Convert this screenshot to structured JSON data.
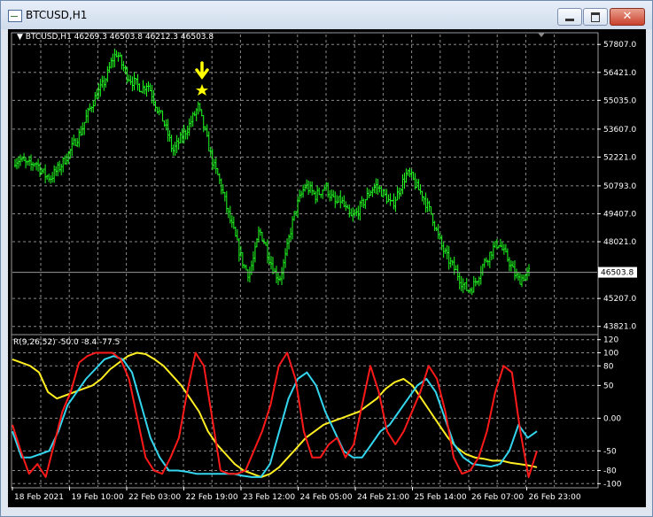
{
  "window": {
    "title": "BTCUSD,H1",
    "buttons": {
      "minimize": "minimize",
      "maximize": "maximize",
      "close": "✕"
    }
  },
  "price_pane": {
    "header": "▼ BTCUSD,H1  46269.3 46503.8 46212.3 46503.8",
    "current_price_label": "46503.8",
    "y_ticks": [
      "57807.0",
      "56421.0",
      "55035.0",
      "53607.0",
      "52221.0",
      "50793.0",
      "49407.0",
      "48021.0",
      "45207.0",
      "43821.0"
    ],
    "marker_icons": [
      "arrow-down-icon",
      "star-icon"
    ],
    "colors": {
      "candles": "#20ff20",
      "marker": "#ffff00",
      "grid": "#8a8a8a"
    }
  },
  "indicator_pane": {
    "header": "R(9,26,52) -50.0 -8.4 -77.5",
    "y_ticks": [
      "120",
      "100",
      "80",
      "50",
      "0.00",
      "-50",
      "-80",
      "-100"
    ],
    "colors": {
      "fast": "#ff1a1a",
      "mid": "#33d6ee",
      "slow": "#ffee22"
    }
  },
  "x_axis": {
    "labels": [
      "18 Feb 2021",
      "19 Feb 10:00",
      "22 Feb 03:00",
      "22 Feb 19:00",
      "23 Feb 12:00",
      "24 Feb 05:00",
      "24 Feb 21:00",
      "25 Feb 14:00",
      "26 Feb 07:00",
      "26 Feb 23:00"
    ]
  },
  "chart_data": [
    {
      "type": "candlestick",
      "y_ticks": [
        57807.0,
        56421.0,
        55035.0,
        53607.0,
        52221.0,
        50793.0,
        49407.0,
        48021.0,
        45207.0,
        43821.0
      ],
      "ylim": [
        43500,
        58300
      ],
      "last_price": 46503.8,
      "ohlc_last": [
        46269.3,
        46503.8,
        46212.3,
        46503.8
      ],
      "close_path": [
        52050,
        52100,
        51900,
        51800,
        52000,
        51600,
        51300,
        51200,
        51500,
        51800,
        52200,
        52600,
        53100,
        53500,
        54200,
        54800,
        55300,
        55700,
        56200,
        57000,
        57400,
        56800,
        56300,
        56000,
        55800,
        55600,
        55900,
        55300,
        54600,
        54100,
        53400,
        52500,
        52900,
        53300,
        53700,
        54200,
        54700,
        53800,
        52800,
        51800,
        51200,
        50300,
        49300,
        48500,
        47600,
        46800,
        46400,
        47300,
        48600,
        48000,
        47200,
        46500,
        46200,
        47100,
        48400,
        49500,
        50200,
        50800,
        50600,
        50300,
        50500,
        50800,
        50300,
        49900,
        50100,
        49600,
        49200,
        49400,
        49800,
        50200,
        50600,
        50800,
        50500,
        50200,
        49800,
        50300,
        50900,
        51400,
        51200,
        50700,
        50400,
        49800,
        49300,
        48400,
        47700,
        47200,
        46800,
        46400,
        45900,
        45600,
        45800,
        46300,
        46900,
        47300,
        47700,
        48000,
        47500,
        47100,
        46500,
        46100,
        46300,
        46500
      ]
    },
    {
      "type": "line",
      "series_values": {
        "fast": [
          -10,
          -50,
          -85,
          -70,
          -90,
          -40,
          10,
          40,
          85,
          95,
          100,
          100,
          100,
          90,
          60,
          0,
          -60,
          -80,
          -85,
          -60,
          -30,
          40,
          100,
          80,
          0,
          -80,
          -85,
          -85,
          -80,
          -50,
          -20,
          20,
          80,
          100,
          60,
          -20,
          -60,
          -60,
          -40,
          -30,
          -60,
          -40,
          20,
          80,
          40,
          -20,
          -40,
          -20,
          10,
          40,
          80,
          60,
          10,
          -60,
          -85,
          -80,
          -60,
          -20,
          40,
          80,
          70,
          -20,
          -90,
          -50
        ],
        "mid": [
          -20,
          -60,
          -60,
          -55,
          -50,
          -20,
          20,
          40,
          60,
          75,
          90,
          95,
          90,
          70,
          20,
          -30,
          -60,
          -80,
          -80,
          -82,
          -85,
          -85,
          -85,
          -85,
          -85,
          -88,
          -90,
          -90,
          -70,
          -20,
          30,
          60,
          70,
          50,
          10,
          -20,
          -50,
          -60,
          -60,
          -40,
          -20,
          -10,
          10,
          30,
          50,
          60,
          40,
          0,
          -40,
          -60,
          -70,
          -72,
          -74,
          -70,
          -50,
          -10,
          -30,
          -20
        ],
        "slow": [
          90,
          85,
          80,
          70,
          40,
          30,
          35,
          40,
          45,
          50,
          60,
          75,
          85,
          95,
          100,
          98,
          90,
          80,
          65,
          50,
          30,
          10,
          -20,
          -40,
          -55,
          -70,
          -80,
          -85,
          -90,
          -85,
          -75,
          -60,
          -45,
          -30,
          -20,
          -10,
          -5,
          0,
          5,
          10,
          20,
          30,
          45,
          55,
          60,
          50,
          30,
          10,
          -10,
          -30,
          -45,
          -55,
          -60,
          -62,
          -65,
          -65,
          -68,
          -70,
          -72,
          -75
        ]
      },
      "y_ticks": [
        120,
        100,
        80,
        50,
        0,
        -50,
        -80,
        -100
      ],
      "ylim": [
        -105,
        125
      ]
    }
  ]
}
